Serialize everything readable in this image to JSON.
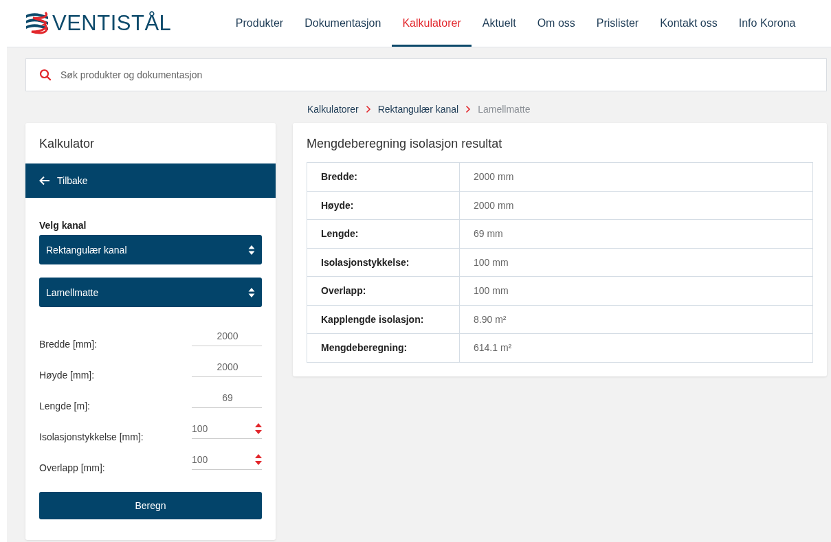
{
  "header": {
    "logo": "VENTISTÅL",
    "nav": [
      {
        "label": "Produkter",
        "selected": false
      },
      {
        "label": "Dokumentasjon",
        "selected": false
      },
      {
        "label": "Kalkulatorer",
        "selected": true
      },
      {
        "label": "Aktuelt",
        "selected": false
      },
      {
        "label": "Om oss",
        "selected": false
      },
      {
        "label": "Prislister",
        "selected": false
      },
      {
        "label": "Kontakt oss",
        "selected": false
      },
      {
        "label": "Info Korona",
        "selected": false
      }
    ]
  },
  "search": {
    "placeholder": "Søk produkter og dokumentasjon"
  },
  "breadcrumb": [
    {
      "label": "Kalkulatorer",
      "current": false
    },
    {
      "label": "Rektangulær kanal",
      "current": false
    },
    {
      "label": "Lamellmatte",
      "current": true
    }
  ],
  "calculator": {
    "title": "Kalkulator",
    "back": "Tilbake",
    "channel_label": "Velg kanal",
    "selects": [
      "Rektangulær kanal",
      "Lamellmatte"
    ],
    "fields": [
      {
        "label": "Bredde [mm]:",
        "value": "2000",
        "kind": "text"
      },
      {
        "label": "Høyde [mm]:",
        "value": "2000",
        "kind": "text"
      },
      {
        "label": "Lengde [m]:",
        "value": "69",
        "kind": "text"
      },
      {
        "label": "Isolasjonstykkelse [mm]:",
        "value": "100",
        "kind": "spinner"
      },
      {
        "label": "Overlapp [mm]:",
        "value": "100",
        "kind": "spinner"
      }
    ],
    "submit": "Beregn"
  },
  "result": {
    "title": "Mengdeberegning isolasjon resultat",
    "rows": [
      {
        "label": "Bredde:",
        "value": "2000 mm"
      },
      {
        "label": "Høyde:",
        "value": "2000 mm"
      },
      {
        "label": "Lengde:",
        "value": "69 mm"
      },
      {
        "label": "Isolasjonstykkelse:",
        "value": "100 mm"
      },
      {
        "label": "Overlapp:",
        "value": "100 mm"
      },
      {
        "label": "Kapplengde isolasjon:",
        "value": "8.90 m²"
      },
      {
        "label": "Mengdeberegning:",
        "value": "614.1 m²"
      }
    ]
  }
}
